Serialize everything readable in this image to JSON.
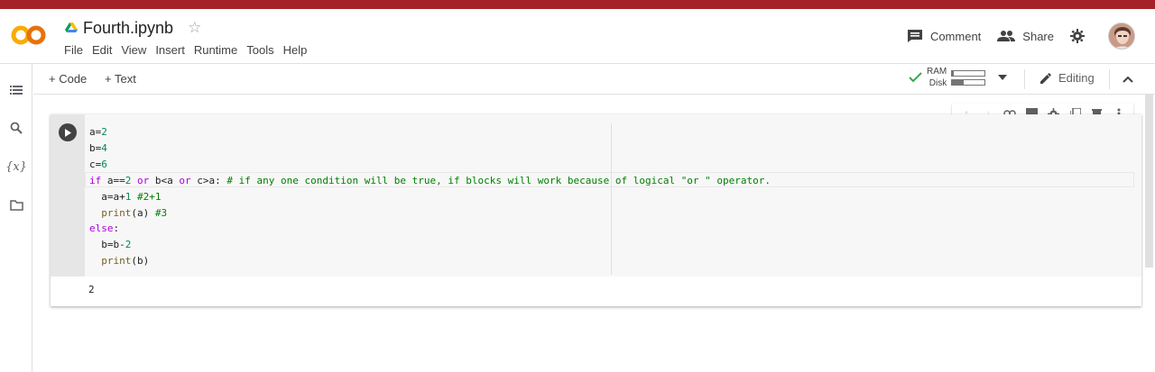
{
  "header": {
    "title": "Fourth.ipynb",
    "menu": [
      "File",
      "Edit",
      "View",
      "Insert",
      "Runtime",
      "Tools",
      "Help"
    ],
    "comment_label": "Comment",
    "share_label": "Share"
  },
  "toolbar": {
    "add_code": "+ Code",
    "add_text": "+ Text",
    "ram_label": "RAM",
    "disk_label": "Disk",
    "ram_usage": 0.05,
    "disk_usage": 0.35,
    "editing_label": "Editing"
  },
  "cell": {
    "code_lines": [
      "a=2",
      "b=4",
      "c=6",
      "if a==2 or b<a or c>a: # if any one condition will be true, if blocks will work because of logical \"or \" operator.",
      "  a=a+1 #2+1",
      "  print(a) #3",
      "else:",
      "  b=b-2",
      "  print(b)"
    ],
    "output": "2"
  },
  "colors": {
    "topbar": "#a52226",
    "keyword": "#af00db",
    "number": "#098658",
    "comment": "#008000",
    "function": "#795e26"
  }
}
